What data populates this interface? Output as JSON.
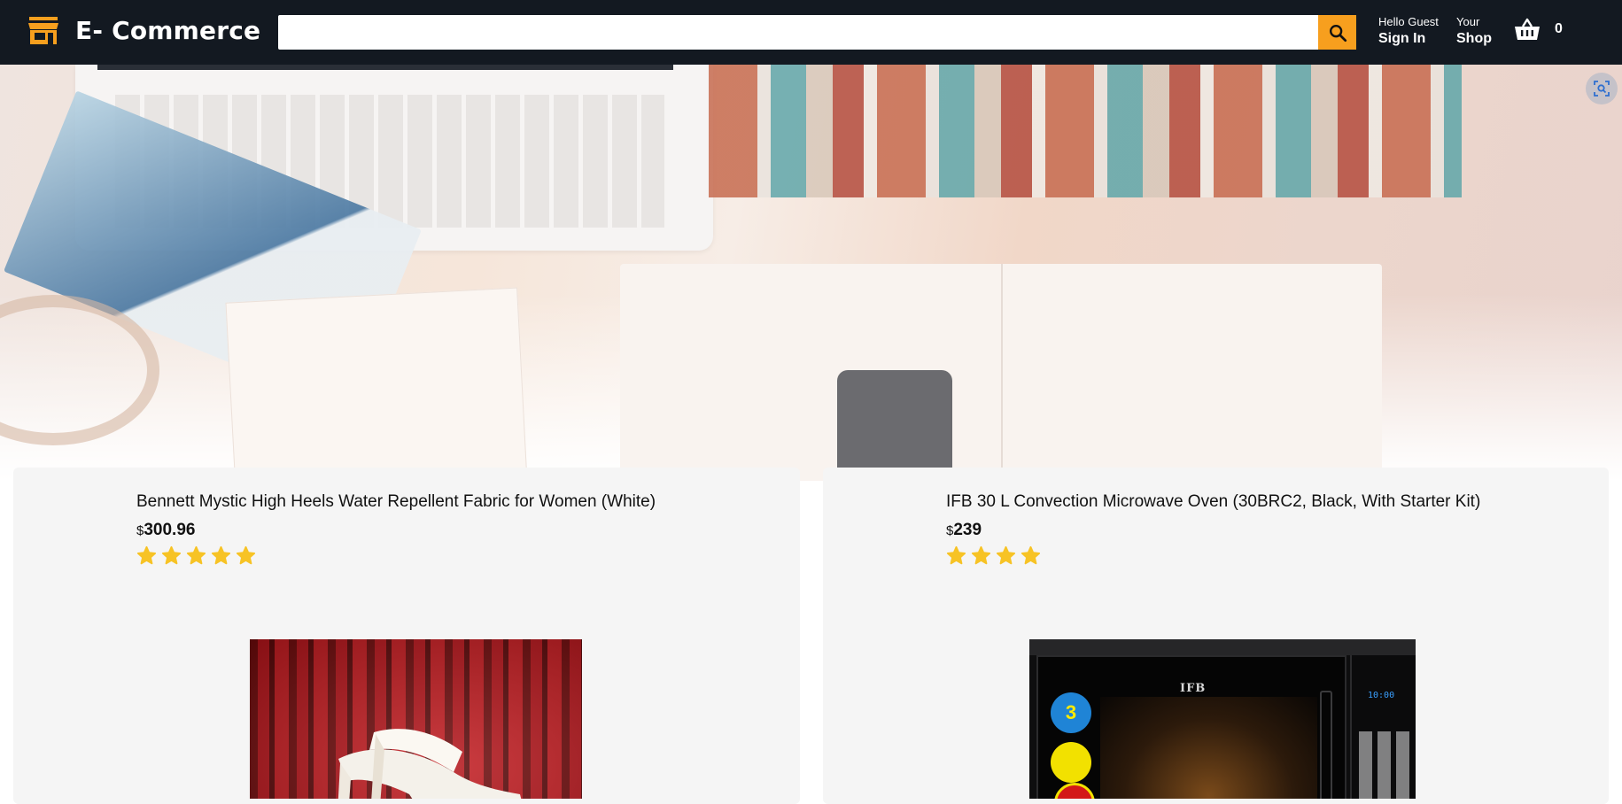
{
  "header": {
    "brand_name": "E- Commerce",
    "brand_icon": "store-icon",
    "brand_icon_color": "#f79f1e",
    "background_color": "#131921",
    "search": {
      "value": "",
      "placeholder": "",
      "button_icon": "search-icon",
      "button_color": "#f79f1e"
    },
    "nav": [
      {
        "line_one": "Hello Guest",
        "line_two": "Sign In"
      },
      {
        "line_one": "Your",
        "line_two": "Shop"
      }
    ],
    "basket": {
      "icon": "basket-icon",
      "count": "0"
    }
  },
  "hero": {
    "overlay_icon": "visual-search-icon"
  },
  "products": [
    {
      "title": "Bennett Mystic High Heels Water Repellent Fabric for Women (White)",
      "currency": "$",
      "price": "300.96",
      "rating": 5,
      "image": "white-high-heels"
    },
    {
      "title": "IFB 30 L Convection Microwave Oven (30BRC2, Black, With Starter Kit)",
      "currency": "$",
      "price": "239",
      "rating": 4,
      "image": "ifb-microwave",
      "image_text": {
        "brand": "IFB",
        "display": "10:00",
        "badge": "3"
      }
    }
  ],
  "colors": {
    "accent": "#f79f1e",
    "star": "#f7c325",
    "card_background": "#f5f5f5"
  }
}
